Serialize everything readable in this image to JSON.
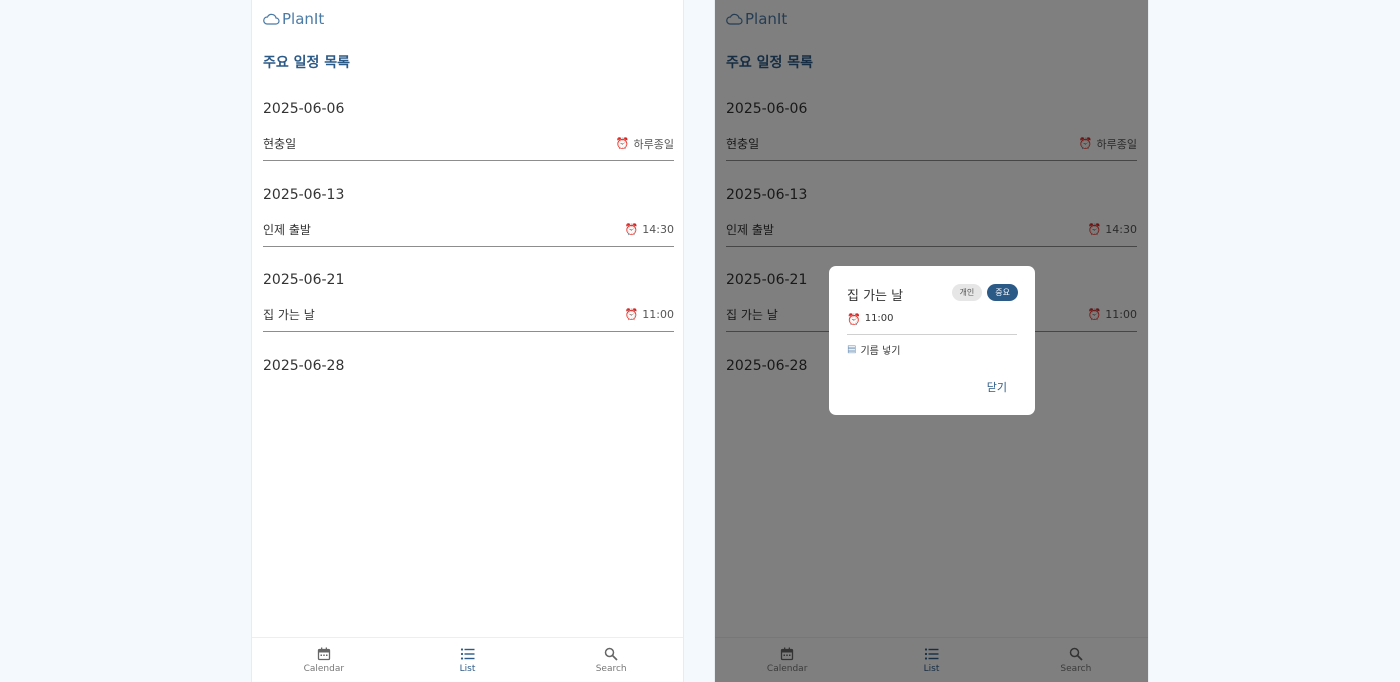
{
  "app": {
    "name": "PlanIt"
  },
  "page_title": "주요 일정 목록",
  "schedule": [
    {
      "date": "2025-06-06",
      "title": "현충일",
      "time": "하루종일"
    },
    {
      "date": "2025-06-13",
      "title": "인제 출발",
      "time": "14:30"
    },
    {
      "date": "2025-06-21",
      "title": "집 가는 날",
      "time": "11:00"
    },
    {
      "date": "2025-06-28"
    }
  ],
  "nav": {
    "calendar": "Calendar",
    "list": "List",
    "search": "Search"
  },
  "dialog": {
    "title": "집 가는 날",
    "tag_personal": "개인",
    "tag_important": "중요",
    "time": "11:00",
    "memo": "기름 넣기",
    "close_label": "닫기"
  },
  "colors": {
    "accent": "#2c5a87",
    "logo": "#4a7aa6",
    "clock": "#d93b2b",
    "background": "#f3f9fd"
  },
  "icons": {
    "logo": "cloud-icon",
    "time": "alarm-clock-icon",
    "memo": "memo-icon",
    "calendar": "calendar-icon",
    "list": "list-icon",
    "search": "search-icon"
  }
}
